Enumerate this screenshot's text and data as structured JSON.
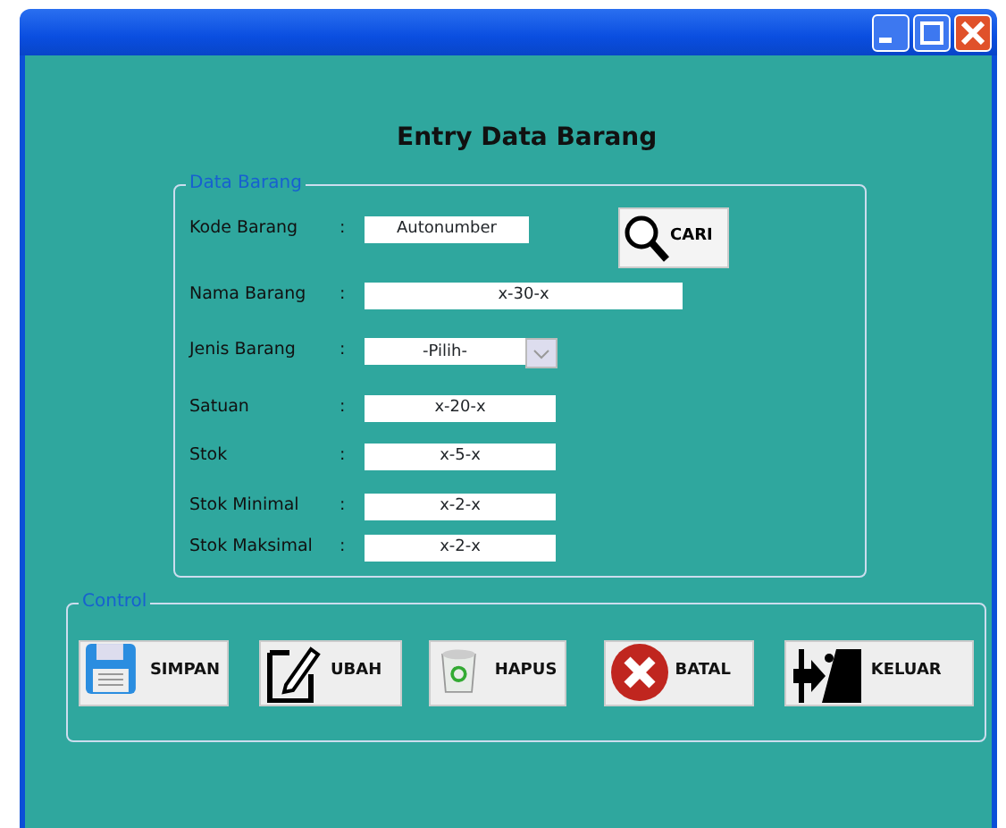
{
  "heading": "Entry Data Barang",
  "data_group": {
    "legend": "Data Barang",
    "fields": [
      {
        "label": "Kode Barang",
        "separator": ":",
        "kind": "text",
        "value": "Autonumber"
      },
      {
        "label": "Nama Barang",
        "separator": ":",
        "kind": "text",
        "value": "x-30-x"
      },
      {
        "label": "Jenis Barang",
        "separator": ":",
        "kind": "combo",
        "value": "-Pilih-"
      },
      {
        "label": "Satuan",
        "separator": ":",
        "kind": "text",
        "value": "x-20-x"
      },
      {
        "label": "Stok",
        "separator": ":",
        "kind": "text",
        "value": "x-5-x"
      },
      {
        "label": "Stok Minimal",
        "separator": ":",
        "kind": "text",
        "value": "x-2-x"
      },
      {
        "label": "Stok Maksimal",
        "separator": ":",
        "kind": "text",
        "value": "x-2-x"
      }
    ],
    "search_button": "CARI"
  },
  "control_group": {
    "legend": "Control",
    "buttons": [
      {
        "label": "SIMPAN",
        "kind": "save"
      },
      {
        "label": "UBAH",
        "kind": "edit"
      },
      {
        "label": "HAPUS",
        "kind": "delete"
      },
      {
        "label": "BATAL",
        "kind": "cancel"
      },
      {
        "label": "KELUAR",
        "kind": "exit"
      }
    ]
  }
}
